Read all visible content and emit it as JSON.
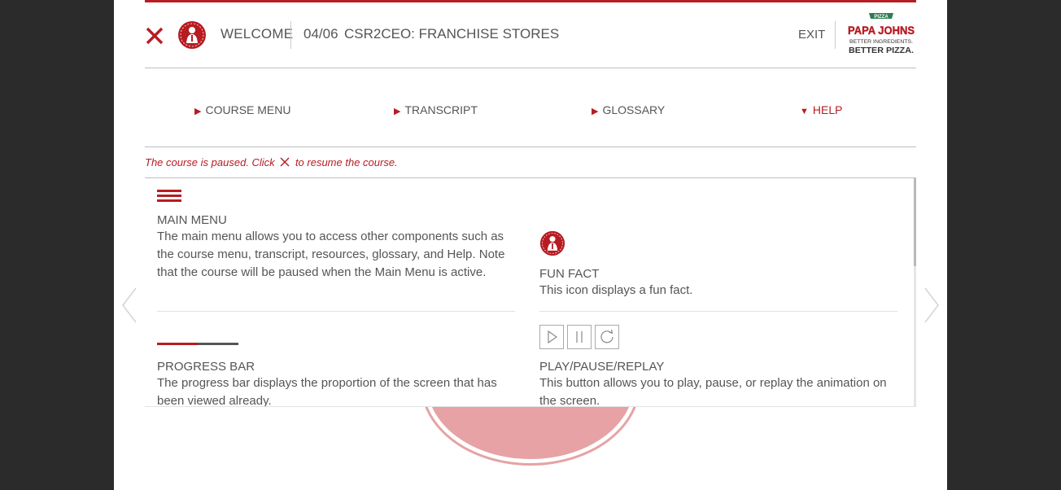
{
  "header": {
    "welcome_label": "WELCOME",
    "counter": "04/06",
    "course_title": "CSR2CEO: FRANCHISE STORES",
    "exit_label": "EXIT",
    "logo": {
      "top_text": "PIZZA",
      "brand_text": "PAPA JOHNS",
      "tagline_1": "BETTER INGREDIENTS.",
      "tagline_2": "BETTER PIZZA."
    }
  },
  "nav": {
    "items": [
      {
        "label": "COURSE MENU",
        "arrow": "▶"
      },
      {
        "label": "TRANSCRIPT",
        "arrow": "▶"
      },
      {
        "label": "GLOSSARY",
        "arrow": "▶"
      },
      {
        "label": "HELP",
        "arrow": "▼"
      }
    ]
  },
  "paused_message": {
    "before": "The course is paused. Click",
    "after": "to resume the course."
  },
  "help_items": [
    {
      "heading": "MAIN MENU",
      "text": "The main menu allows you to access other components such as the course menu, transcript, resources, glossary, and Help. Note that the course will be paused when the Main Menu is active.",
      "icon": "hamburger-menu-icon"
    },
    {
      "heading": "FUN FACT",
      "text": "This icon displays a fun fact.",
      "icon": "papa-john-badge-icon"
    },
    {
      "heading": "PROGRESS BAR",
      "text": "The progress bar displays the proportion of the screen that has been viewed already.",
      "icon": "progress-bar-icon",
      "progress_fraction": 0.5
    },
    {
      "heading": "PLAY/PAUSE/REPLAY",
      "text": "This button allows you to play, pause, or replay the animation on the screen.",
      "icon": "play-pause-replay-icons"
    }
  ],
  "colors": {
    "accent": "#b71c22",
    "text": "#555555",
    "backdrop": "#2b2b2b",
    "bg_circle": "#e6a2a4"
  }
}
